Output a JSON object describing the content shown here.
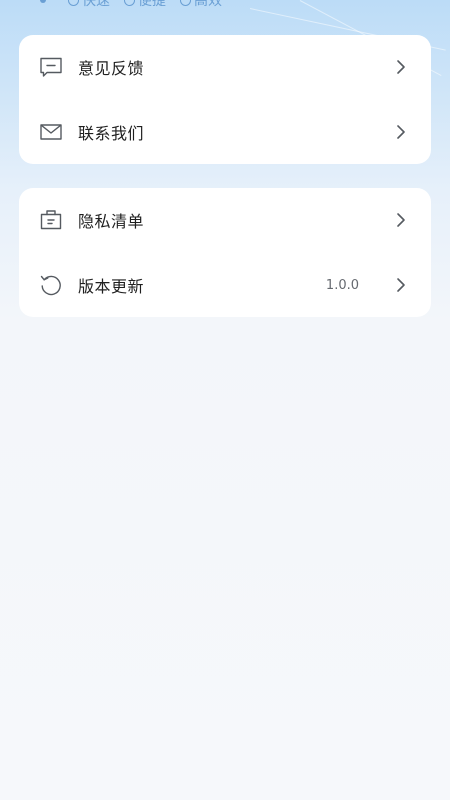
{
  "header": {
    "tags": [
      "快速",
      "便捷",
      "高效"
    ]
  },
  "group1": {
    "items": [
      {
        "label": "意见反馈",
        "icon": "feedback-icon"
      },
      {
        "label": "联系我们",
        "icon": "mail-icon"
      }
    ]
  },
  "group2": {
    "items": [
      {
        "label": "隐私清单",
        "icon": "privacy-list-icon"
      },
      {
        "label": "版本更新",
        "icon": "refresh-icon",
        "value": "1.0.0"
      }
    ]
  },
  "colors": {
    "background_top": "#bcdcf7",
    "background_bottom": "#f6f8fb",
    "card": "#ffffff",
    "text": "#1f1f1f",
    "icon": "#555a60",
    "tag": "#6a9fd4"
  }
}
